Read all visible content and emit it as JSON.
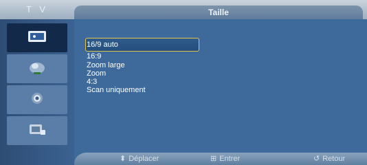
{
  "topbar": {
    "tv_label": "T V",
    "title": "Taille"
  },
  "sidebar": {
    "items": [
      {
        "icon": "picture-icon",
        "active": true
      },
      {
        "icon": "sound-icon",
        "active": false
      },
      {
        "icon": "settings-icon",
        "active": false
      },
      {
        "icon": "input-icon",
        "active": false
      }
    ]
  },
  "menu": {
    "items": [
      {
        "label": "16/9 auto",
        "selected": true
      },
      {
        "label": "16:9",
        "selected": false
      },
      {
        "label": "Zoom large",
        "selected": false
      },
      {
        "label": "Zoom",
        "selected": false
      },
      {
        "label": "4:3",
        "selected": false
      },
      {
        "label": "Scan uniquement",
        "selected": false
      }
    ]
  },
  "footer": {
    "move_icon": "updown-icon",
    "move_label": "Déplacer",
    "enter_icon": "enter-icon",
    "enter_label": "Entrer",
    "return_icon": "return-icon",
    "return_label": "Retour"
  },
  "colors": {
    "background": "#3e6a9b",
    "sidebar_active": "#13294a",
    "selection_border": "#e2c44c"
  }
}
